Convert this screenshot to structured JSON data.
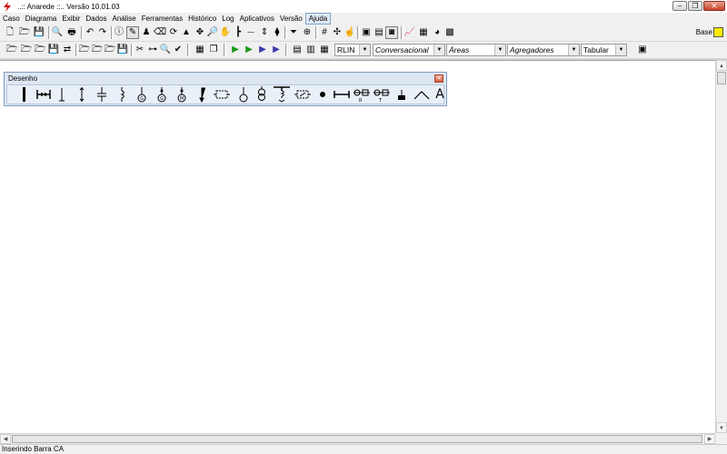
{
  "window": {
    "title": "..:: Anarede ::.. Versão 10.01.03"
  },
  "menu": {
    "items": [
      "Caso",
      "Diagrama",
      "Exibir",
      "Dados",
      "Análise",
      "Ferramentas",
      "Histórico",
      "Log",
      "Aplicativos",
      "Versão",
      "Ajuda"
    ],
    "active": "Ajuda"
  },
  "toolbar2": {
    "combos": [
      {
        "value": "RLIN",
        "italic": false
      },
      {
        "value": "Conversacional",
        "italic": true
      },
      {
        "value": "Áreas",
        "italic": true
      },
      {
        "value": "Agregadores",
        "italic": true
      },
      {
        "value": "Tabular",
        "italic": false
      }
    ]
  },
  "base": {
    "label": "Base",
    "color": "#ffeb00"
  },
  "palette": {
    "title": "Desenho",
    "last_tool_label": "A"
  },
  "status": {
    "text": "Inserindo Barra CA"
  },
  "colors": {
    "accent": "#cc0000",
    "menu_active_border": "#7fa4c9",
    "palette_bg": "#dde6f3"
  }
}
